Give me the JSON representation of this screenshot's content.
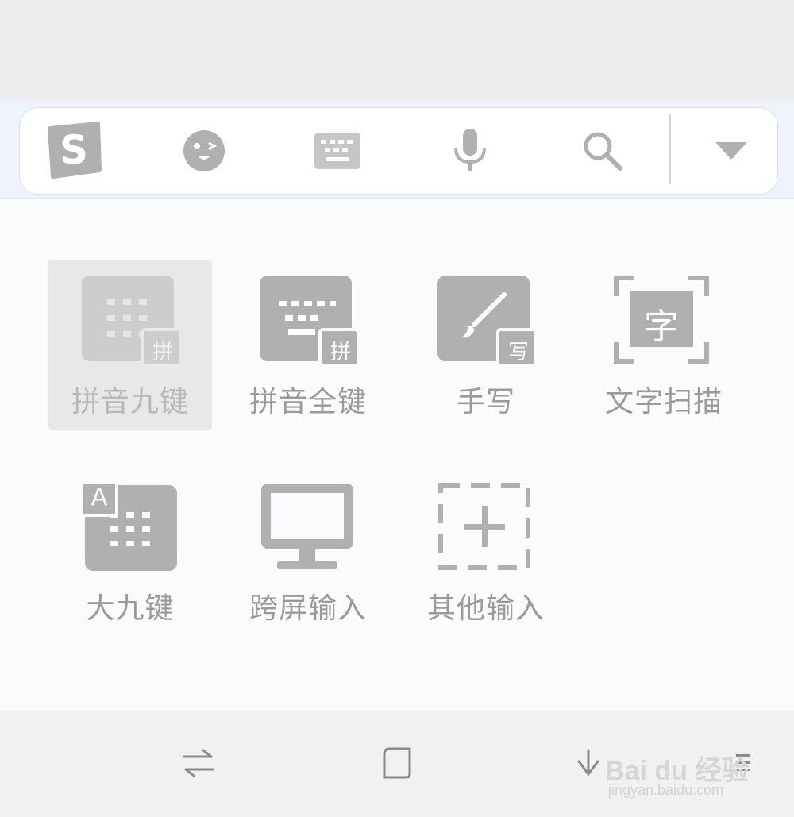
{
  "toolbar": {
    "icons": [
      "sogou-logo-icon",
      "emoji-icon",
      "keyboard-icon",
      "microphone-icon",
      "search-icon",
      "collapse-arrow-icon"
    ]
  },
  "modes": [
    {
      "label": "拼音九键",
      "badge": "拼",
      "icon": "pinyin-nine-key-icon",
      "selected": true
    },
    {
      "label": "拼音全键",
      "badge": "拼",
      "icon": "pinyin-full-key-icon",
      "selected": false
    },
    {
      "label": "手写",
      "badge": "写",
      "icon": "handwriting-icon",
      "selected": false
    },
    {
      "label": "文字扫描",
      "badge": "字",
      "icon": "text-scan-icon",
      "selected": false
    },
    {
      "label": "大九键",
      "badge": "A",
      "icon": "big-nine-key-icon",
      "selected": false
    },
    {
      "label": "跨屏输入",
      "badge": "",
      "icon": "cross-screen-icon",
      "selected": false
    },
    {
      "label": "其他输入",
      "badge": "",
      "icon": "other-input-icon",
      "selected": false
    }
  ],
  "navbar": {
    "icons": [
      "switch-icon",
      "home-icon",
      "hide-keyboard-icon",
      "menu-icon"
    ]
  },
  "watermark": {
    "brand": "Bai du 经验",
    "url": "jingyan.baidu.com"
  },
  "colors": {
    "icon_gray": "#b0b0b0",
    "label_gray": "#9a9a9a",
    "selected_bg": "#e8e8e8"
  }
}
